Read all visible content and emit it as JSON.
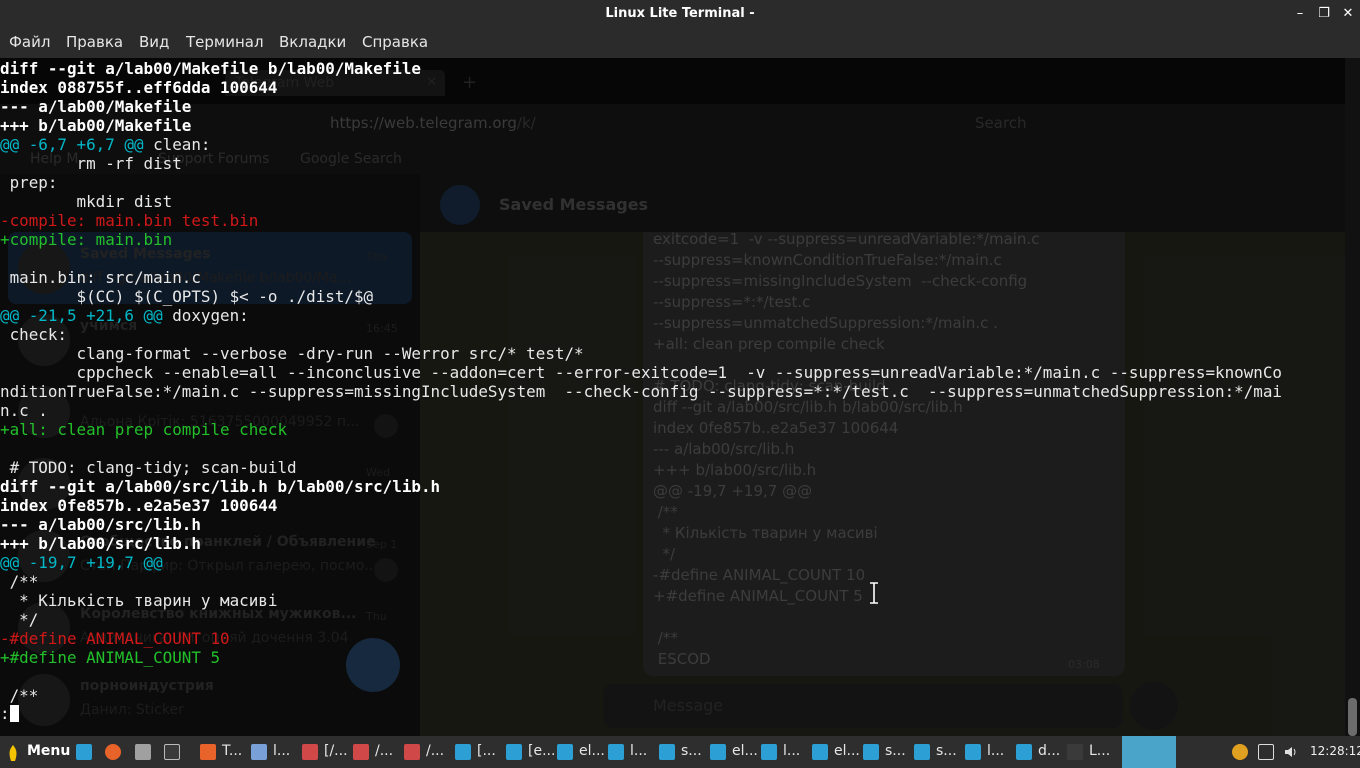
{
  "window": {
    "title": "Linux Lite Terminal -"
  },
  "menu": [
    "Файл",
    "Правка",
    "Вид",
    "Терминал",
    "Вкладки",
    "Справка"
  ],
  "background_browser": {
    "tab_title": "Telegram Web",
    "url_host": "https://web.telegram.org",
    "url_path": "/k/",
    "search_placeholder": "Search",
    "bookmarks": [
      "Help M",
      "Support Forums",
      "Google Search"
    ],
    "chat_header": "Saved Messages",
    "chats": [
      {
        "name": "Saved Messages",
        "preview": "diff --git a/lab00/Makefile b/lab00/Ma...",
        "time": "Thu"
      },
      {
        "name": "учимся",
        "preview": "",
        "time": "16:45"
      },
      {
        "name": "",
        "preview": "Альона Крітік: 5163755000049952 п...",
        "time": ""
      },
      {
        "name": "",
        "preview": "",
        "time": "Wed"
      },
      {
        "name": "Сообщество пранклей / Объявление",
        "preview": "Стоп Парфир: Открыл галерею, посмо...",
        "time": "Sep 1"
      },
      {
        "name": "Королевство книжных мужиков...",
        "preview": "Аудиокнига: Ригоцияй дочення 3.04",
        "time": "Thu"
      },
      {
        "name": "порноиндустрия",
        "preview": "Данил: Sticker",
        "time": ""
      }
    ],
    "message_lines": [
      "exitcode=1  -v --suppress=unreadVariable:*/main.c",
      "--suppress=knownConditionTrueFalse:*/main.c",
      "--suppress=missingIncludeSystem  --check-config",
      "--suppress=*:*/test.c",
      "--suppress=unmatchedSuppression:*/main.c .",
      "+all: clean prep compile check",
      "",
      "# TODO: clang-tidy; scan-build",
      "diff --git a/lab00/src/lib.h b/lab00/src/lib.h",
      "index 0fe857b..e2a5e37 100644",
      "--- a/lab00/src/lib.h",
      "+++ b/lab00/src/lib.h",
      "@@ -19,7 +19,7 @@",
      " /**",
      "  * Кількість тварин у масиві",
      "  */",
      "-#define ANIMAL_COUNT 10",
      "+#define ANIMAL_COUNT 5",
      "",
      " /**",
      " ESCOD"
    ],
    "message_time": "03:08",
    "input_placeholder": "Message"
  },
  "terminal": {
    "lines": [
      {
        "kind": "bold",
        "text": "diff --git a/lab00/Makefile b/lab00/Makefile"
      },
      {
        "kind": "bold",
        "text": "index 088755f..eff6dda 100644"
      },
      {
        "kind": "bold",
        "text": "--- a/lab00/Makefile"
      },
      {
        "kind": "bold",
        "text": "+++ b/lab00/Makefile"
      },
      {
        "kind": "hunk",
        "text": "@@ -6,7 +6,7 @@",
        "rest": " clean:"
      },
      {
        "kind": "ctx",
        "text": "        rm -rf dist"
      },
      {
        "kind": "ctx",
        "text": " prep:"
      },
      {
        "kind": "ctx",
        "text": "        mkdir dist"
      },
      {
        "kind": "del",
        "text": "-compile: main.bin test.bin"
      },
      {
        "kind": "add",
        "text": "+compile: main.bin"
      },
      {
        "kind": "ctx",
        "text": ""
      },
      {
        "kind": "ctx",
        "text": " main.bin: src/main.c"
      },
      {
        "kind": "ctx",
        "text": "        $(CC) $(C_OPTS) $< -o ./dist/$@"
      },
      {
        "kind": "hunk",
        "text": "@@ -21,5 +21,6 @@",
        "rest": " doxygen:"
      },
      {
        "kind": "ctx",
        "text": " check:"
      },
      {
        "kind": "ctx",
        "text": "        clang-format --verbose -dry-run --Werror src/* test/*"
      },
      {
        "kind": "ctx",
        "text": "        cppcheck --enable=all --inconclusive --addon=cert --error-exitcode=1  -v --suppress=unreadVariable:*/main.c --suppress=knownCo"
      },
      {
        "kind": "ctx",
        "text": "nditionTrueFalse:*/main.c --suppress=missingIncludeSystem  --check-config --suppress=*:*/test.c  --suppress=unmatchedSuppression:*/mai"
      },
      {
        "kind": "ctx",
        "text": "n.c ."
      },
      {
        "kind": "add",
        "text": "+all: clean prep compile check"
      },
      {
        "kind": "ctx",
        "text": ""
      },
      {
        "kind": "ctx",
        "text": " # TODO: clang-tidy; scan-build"
      },
      {
        "kind": "bold",
        "text": "diff --git a/lab00/src/lib.h b/lab00/src/lib.h"
      },
      {
        "kind": "bold",
        "text": "index 0fe857b..e2a5e37 100644"
      },
      {
        "kind": "bold",
        "text": "--- a/lab00/src/lib.h"
      },
      {
        "kind": "bold",
        "text": "+++ b/lab00/src/lib.h"
      },
      {
        "kind": "hunk",
        "text": "@@ -19,7 +19,7 @@",
        "rest": ""
      },
      {
        "kind": "ctx",
        "text": " /**"
      },
      {
        "kind": "ctx",
        "text": "  * Кількість тварин у масиві"
      },
      {
        "kind": "ctx",
        "text": "  */"
      },
      {
        "kind": "del",
        "text": "-#define ANIMAL_COUNT 10"
      },
      {
        "kind": "add",
        "text": "+#define ANIMAL_COUNT 5"
      },
      {
        "kind": "ctx",
        "text": ""
      },
      {
        "kind": "ctx",
        "text": " /**"
      }
    ],
    "prompt": ":"
  },
  "taskbar": {
    "menu_label": "Menu",
    "items": [
      "T...",
      "l...",
      "[/...",
      "/...",
      "/...",
      "[...",
      "[e...",
      "el...",
      "l...",
      "s...",
      "el...",
      "l...",
      "el...",
      "s...",
      "s...",
      "l...",
      "d...",
      "L..."
    ],
    "clock": "12:28:12"
  },
  "colors": {
    "diff_header": "#ffffff",
    "hunk": "#00b8c8",
    "deletion": "#d01818",
    "addition": "#22c02a",
    "taskbar_active": "#4aa3c8"
  }
}
